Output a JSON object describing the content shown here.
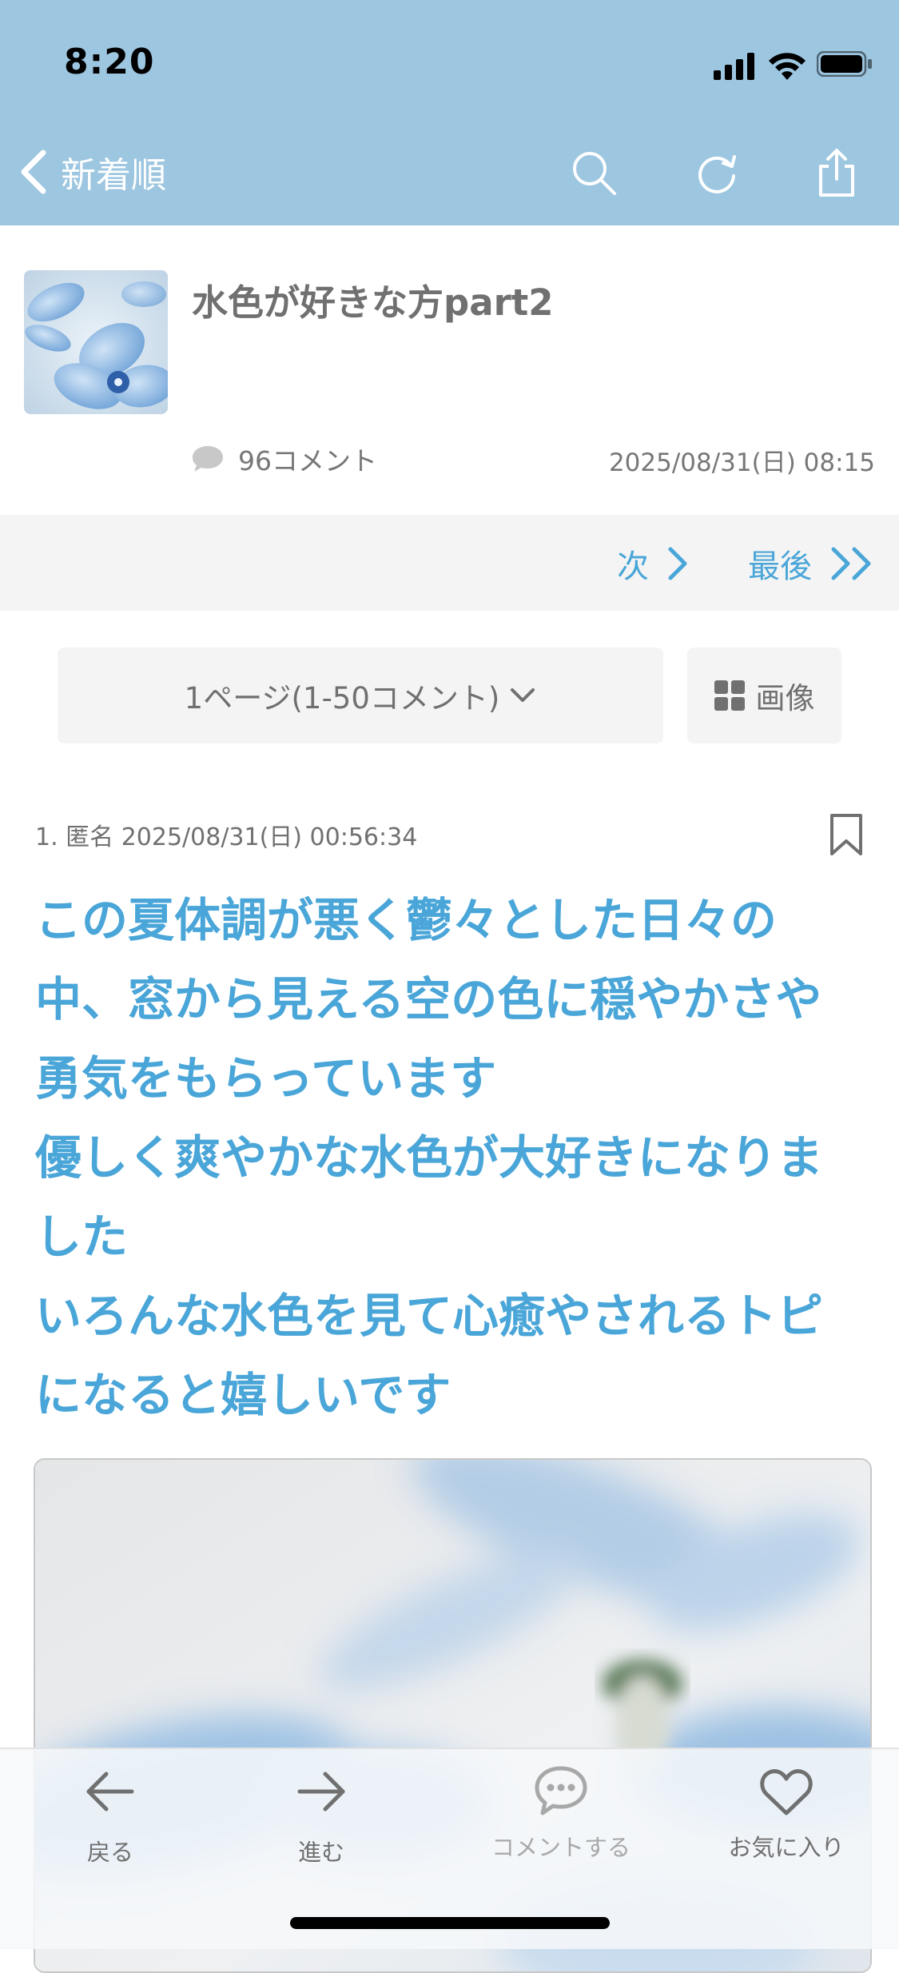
{
  "status_bar": {
    "time": "8:20"
  },
  "nav": {
    "back_label": "新着順",
    "icons": [
      "search-icon",
      "refresh-icon",
      "share-icon"
    ],
    "bar_color": "#9dc6e0"
  },
  "thread": {
    "title": "水色が好きな方part2",
    "comment_count": "96コメント",
    "posted_at": "2025/08/31(日) 08:15"
  },
  "pager": {
    "next_label": "次",
    "last_label": "最後",
    "page_select": "1ページ(1-50コメント)",
    "image_label": "画像"
  },
  "post": {
    "meta": "1. 匿名 2025/08/31(日) 00:56:34",
    "lines": [
      "この夏体調が悪く鬱々とした日々の",
      "中、窓から見える空の色に穏やかさや",
      "勇気をもらっています",
      "優しく爽やかな水色が大好きになりま",
      "した",
      "いろんな水色を見て心癒やされるトピ",
      "になると嬉しいです"
    ]
  },
  "toolbar": {
    "back": "戻る",
    "forward": "進む",
    "comment": "コメントする",
    "favorite": "お気に入り"
  },
  "colors": {
    "accent": "#4aa6d8",
    "muted_text": "#707070"
  }
}
